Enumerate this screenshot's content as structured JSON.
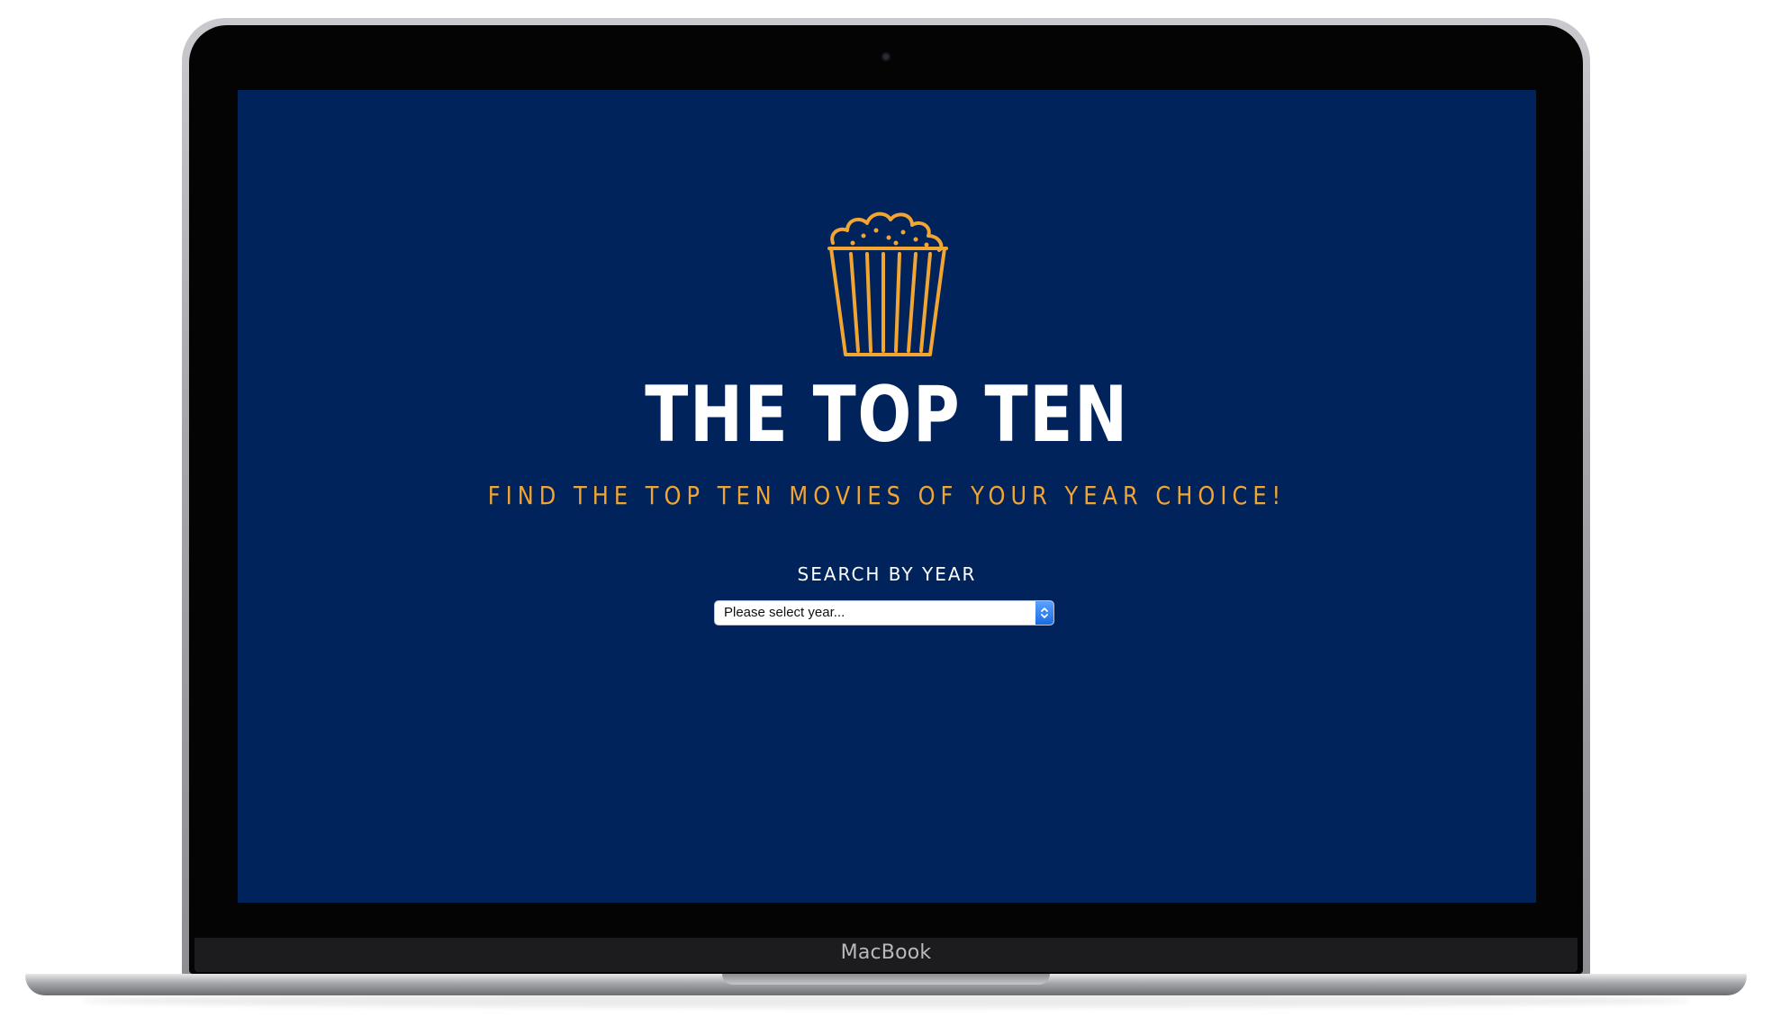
{
  "device": {
    "brand_label": "MacBook"
  },
  "page": {
    "background_color": "#00235c",
    "accent_color": "#f2a531",
    "logo_icon": "popcorn-icon",
    "title": "THE TOP TEN",
    "subtitle": "FIND THE TOP TEN MOVIES OF YOUR YEAR CHOICE!",
    "search": {
      "label": "SEARCH BY YEAR",
      "select_value": "Please select year...",
      "select_icon": "chevron-up-down-icon"
    }
  }
}
